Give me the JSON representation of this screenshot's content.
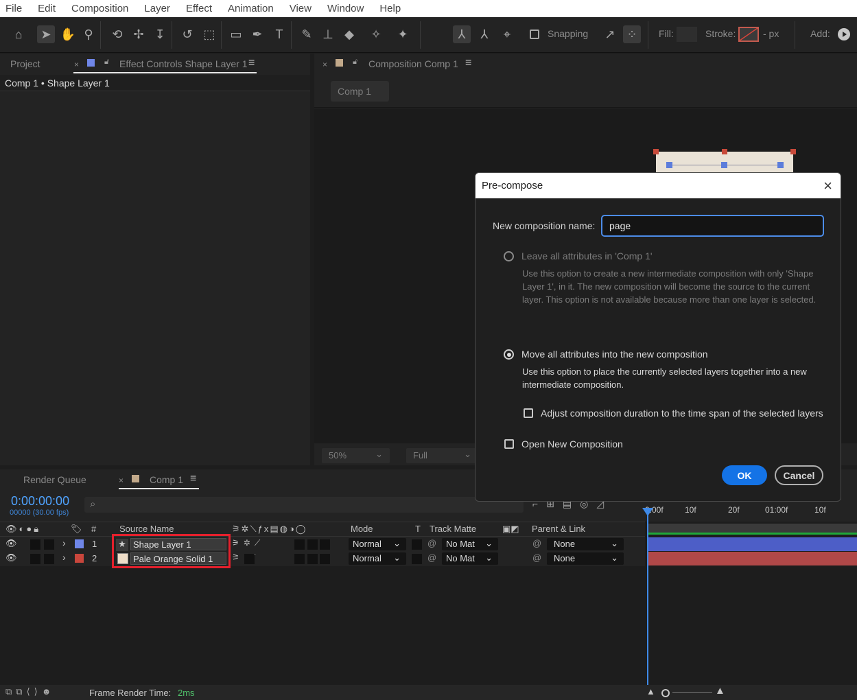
{
  "menu": [
    "File",
    "Edit",
    "Composition",
    "Layer",
    "Effect",
    "Animation",
    "View",
    "Window",
    "Help"
  ],
  "toolbar": {
    "snapping_label": "Snapping",
    "fill_label": "Fill:",
    "stroke_label": "Stroke:",
    "stroke_px": "- px",
    "add_label": "Add:"
  },
  "project_panel": {
    "tab_project": "Project",
    "tab_effect_controls": "Effect Controls Shape Layer 1",
    "breadcrumb": "Comp 1 • Shape Layer 1"
  },
  "comp_panel": {
    "tab_label": "Composition Comp 1",
    "comp_chip": "Comp 1",
    "zoom": "50%",
    "resolution": "Full"
  },
  "dialog": {
    "title": "Pre-compose",
    "name_label": "New composition name:",
    "name_value": "page",
    "option1_title": "Leave all attributes in 'Comp 1'",
    "option1_desc": "Use this option to create a new intermediate composition with only 'Shape Layer 1', in it. The new composition will become the source to the current layer. This option is not available because more than one layer is selected.",
    "option2_title": "Move all attributes into the new composition",
    "option2_desc": "Use this option to place the currently selected layers together into a new intermediate composition.",
    "adjust_label": "Adjust composition duration to the time span of the selected layers",
    "open_label": "Open New Composition",
    "ok_label": "OK",
    "cancel_label": "Cancel",
    "selected_option": "option2"
  },
  "timeline": {
    "tab_render_queue": "Render Queue",
    "tab_comp": "Comp 1",
    "timecode": "0:00:00:00",
    "frame_info": "00000 (30.00 fps)",
    "search_glyph": "⌕",
    "columns": {
      "number": "#",
      "source_name": "Source Name",
      "mode": "Mode",
      "t": "T",
      "track_matte": "Track Matte",
      "parent": "Parent & Link"
    },
    "ruler": [
      "0:00f",
      "10f",
      "20f",
      "01:00f",
      "10f"
    ],
    "layers": [
      {
        "num": "1",
        "name": "Shape Layer 1",
        "color": "#6f86e8",
        "mode": "Normal",
        "matte": "No Mat",
        "parent": "None"
      },
      {
        "num": "2",
        "name": "Pale Orange Solid 1",
        "color": "#c9463c",
        "mode": "Normal",
        "matte": "No Mat",
        "parent": "None"
      }
    ],
    "bar_colors": [
      "#4d5ec7",
      "#b04848"
    ]
  },
  "status": {
    "frame_render_label": "Frame Render Time:",
    "frame_render_value": "2ms"
  }
}
